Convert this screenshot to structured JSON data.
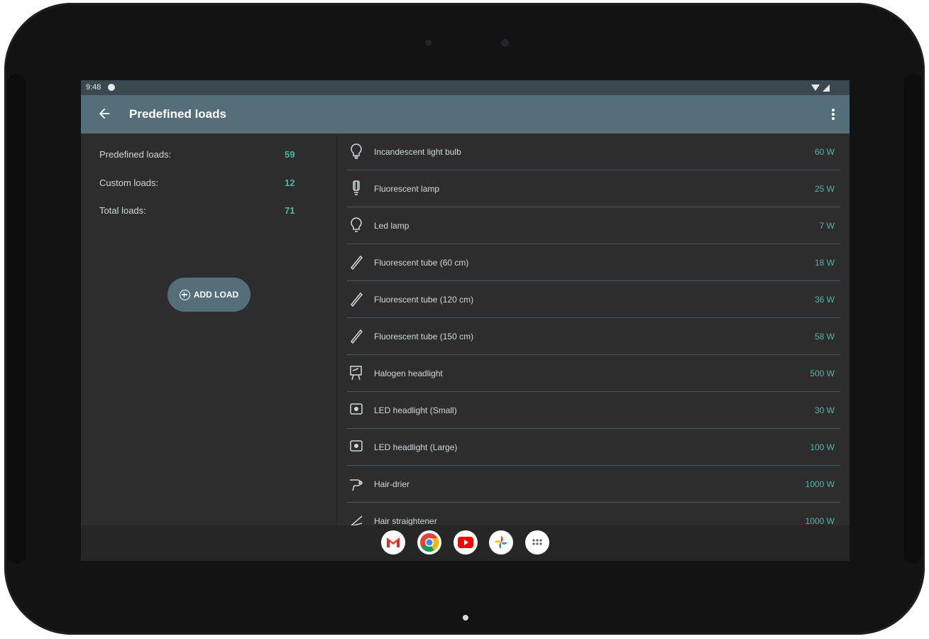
{
  "status_bar": {
    "time": "9:48"
  },
  "app_bar": {
    "title": "Predefined loads"
  },
  "summary": [
    {
      "label": "Predefined loads:",
      "value": "59"
    },
    {
      "label": "Custom loads:",
      "value": "12"
    },
    {
      "label": "Total loads:",
      "value": "71"
    }
  ],
  "add_button": {
    "label": "ADD LOAD"
  },
  "loads": [
    {
      "name": "Incandescent light bulb",
      "power": "60 W",
      "icon": "bulb-icon"
    },
    {
      "name": "Fluorescent lamp",
      "power": "25 W",
      "icon": "fluorescent-lamp-icon"
    },
    {
      "name": "Led lamp",
      "power": "7 W",
      "icon": "led-bulb-icon"
    },
    {
      "name": "Fluorescent tube (60 cm)",
      "power": "18 W",
      "icon": "tube-icon"
    },
    {
      "name": "Fluorescent tube (120 cm)",
      "power": "36 W",
      "icon": "tube-icon"
    },
    {
      "name": "Fluorescent tube (150 cm)",
      "power": "58 W",
      "icon": "tube-icon"
    },
    {
      "name": "Halogen headlight",
      "power": "500 W",
      "icon": "headlight-icon"
    },
    {
      "name": "LED headlight (Small)",
      "power": "30 W",
      "icon": "led-headlight-icon"
    },
    {
      "name": "LED headlight (Large)",
      "power": "100 W",
      "icon": "led-headlight-icon"
    },
    {
      "name": "Hair-drier",
      "power": "1000 W",
      "icon": "hair-dryer-icon"
    },
    {
      "name": "Hair straightener",
      "power": "1000 W",
      "icon": "hair-straightener-icon"
    }
  ],
  "dock": [
    "gmail-icon",
    "chrome-icon",
    "youtube-icon",
    "photos-icon",
    "app-drawer-icon"
  ],
  "colors": {
    "app_bar": "#546e7a",
    "accent_value": "#4db6ac",
    "background": "#2d2d2d",
    "divider": "#455a64"
  }
}
